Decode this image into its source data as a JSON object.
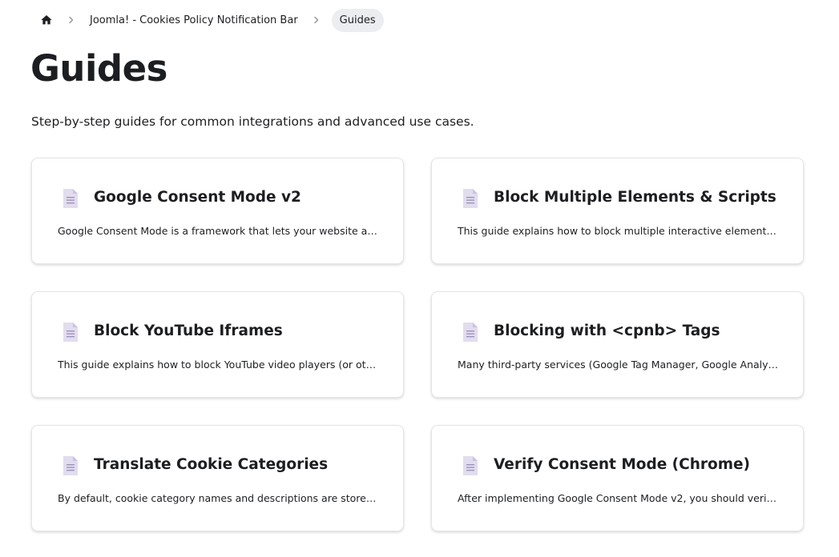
{
  "breadcrumb": {
    "home_icon": "home-icon",
    "separator_icon": "chevron-right-icon",
    "parent_label": "Joomla! - Cookies Policy Notification Bar",
    "current_label": "Guides"
  },
  "page": {
    "title": "Guides",
    "description": "Step-by-step guides for common integrations and advanced use cases."
  },
  "cards": [
    {
      "icon": "document-icon",
      "title": "Google Consent Mode v2",
      "description": "Google Consent Mode is a framework that lets your website adjust th..."
    },
    {
      "icon": "document-icon",
      "title": "Block Multiple Elements & Scripts",
      "description": "This guide explains how to block multiple interactive elements and ex..."
    },
    {
      "icon": "document-icon",
      "title": "Block YouTube Iframes",
      "description": "This guide explains how to block YouTube video players (or other ifra..."
    },
    {
      "icon": "document-icon",
      "title": "Blocking with <cpnb> Tags",
      "description": "Many third-party services (Google Tag Manager, Google Analytics, G..."
    },
    {
      "icon": "document-icon",
      "title": "Translate Cookie Categories",
      "description": "By default, cookie category names and descriptions are stored as plai..."
    },
    {
      "icon": "document-icon",
      "title": "Verify Consent Mode (Chrome)",
      "description": "After implementing Google Consent Mode v2, you should verify that ..."
    }
  ],
  "colors": {
    "icon_page": "#e2dcef",
    "icon_fold": "#cbc2e0",
    "icon_lines": "#9a8fb8",
    "active_crumb_bg": "#ebedf0"
  }
}
